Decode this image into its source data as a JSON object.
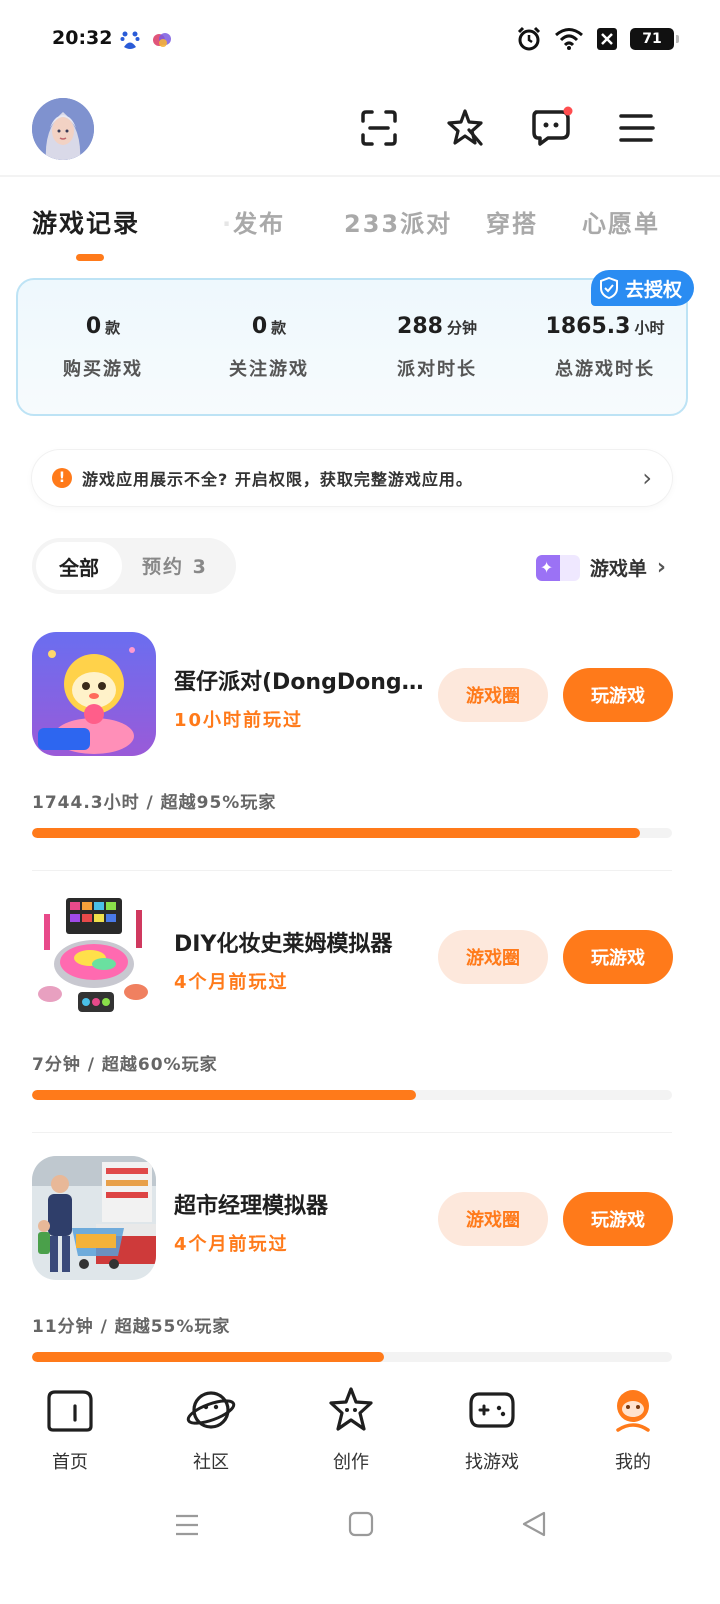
{
  "status_bar": {
    "time": "20:32",
    "app_icons": [
      "baidu-icon",
      "color-app-icon"
    ],
    "indicators": [
      "alarm-icon",
      "wifi-icon",
      "sim-off-icon"
    ],
    "battery": "71"
  },
  "header": {
    "icons": [
      "scan-icon",
      "star-wand-icon",
      "message-icon",
      "menu-icon"
    ]
  },
  "tabs": [
    {
      "label": "游戏记录",
      "active": true
    },
    {
      "label": "发布"
    },
    {
      "label": "233派对"
    },
    {
      "label": "穿搭"
    },
    {
      "label": "心愿单"
    }
  ],
  "stats": {
    "auth_badge": "去授权",
    "items": [
      {
        "value": "0",
        "unit": "款",
        "label": "购买游戏"
      },
      {
        "value": "0",
        "unit": "款",
        "label": "关注游戏"
      },
      {
        "value": "288",
        "unit": "分钟",
        "label": "派对时长"
      },
      {
        "value": "1865.3",
        "unit": "小时",
        "label": "总游戏时长"
      }
    ]
  },
  "notice": {
    "text": "游戏应用展示不全? 开启权限，获取完整游戏应用。"
  },
  "filter": {
    "all": "全部",
    "reserve": "预约 3"
  },
  "game_list_link": "游戏单",
  "games": [
    {
      "title": "蛋仔派对(DongDong...",
      "last_played": "10小时前玩过",
      "circle_btn": "游戏圈",
      "play_btn": "玩游戏",
      "stat": "1744.3小时 / 超越95%玩家",
      "progress": 0.95
    },
    {
      "title": "DIY化妆史莱姆模拟器",
      "last_played": "4个月前玩过",
      "circle_btn": "游戏圈",
      "play_btn": "玩游戏",
      "stat": "7分钟 / 超越60%玩家",
      "progress": 0.6
    },
    {
      "title": "超市经理模拟器",
      "last_played": "4个月前玩过",
      "circle_btn": "游戏圈",
      "play_btn": "玩游戏",
      "stat": "11分钟 / 超越55%玩家",
      "progress": 0.55
    }
  ],
  "bottom_nav": [
    {
      "label": "首页",
      "icon": "home-icon"
    },
    {
      "label": "社区",
      "icon": "planet-icon"
    },
    {
      "label": "创作",
      "icon": "star-icon"
    },
    {
      "label": "找游戏",
      "icon": "gamepad-icon"
    },
    {
      "label": "我的",
      "icon": "profile-icon",
      "active": true
    }
  ],
  "colors": {
    "accent": "#ff7a1a",
    "auth_blue": "#2a8cf2",
    "card_bg": "#eef8fd"
  }
}
